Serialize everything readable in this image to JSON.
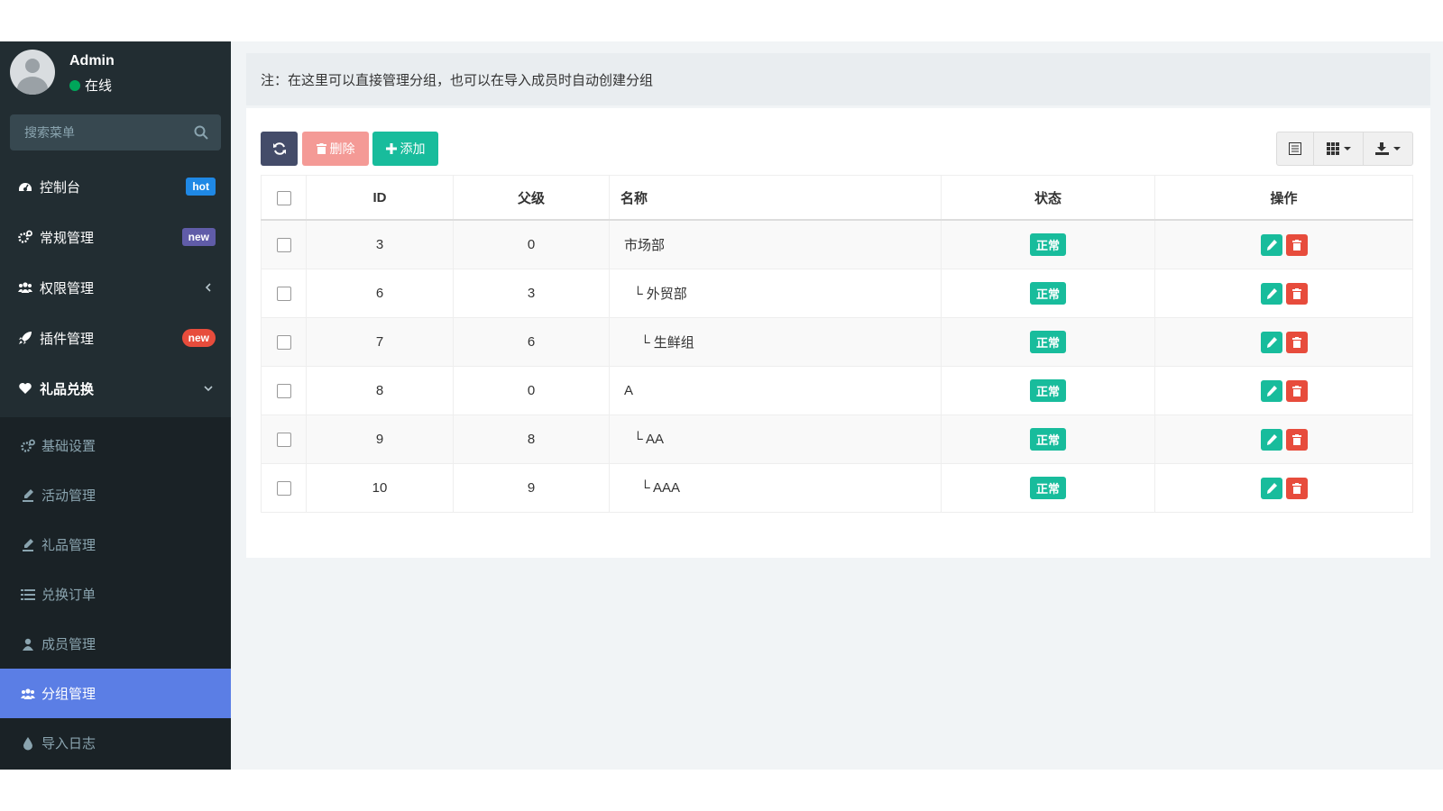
{
  "user": {
    "name": "Admin",
    "status": "在线"
  },
  "search": {
    "placeholder": "搜索菜单"
  },
  "menu": [
    {
      "label": "控制台",
      "icon": "dashboard-icon",
      "badge": "hot",
      "badge_color": "#1f88e5"
    },
    {
      "label": "常规管理",
      "icon": "cogs-icon",
      "badge": "new",
      "badge_color": "#605ca8"
    },
    {
      "label": "权限管理",
      "icon": "group-icon",
      "chevron": "left"
    },
    {
      "label": "插件管理",
      "icon": "rocket-icon",
      "badge": "new",
      "badge_color": "#e74c3c"
    },
    {
      "label": "礼品兑换",
      "icon": "heart-icon",
      "chevron": "down"
    }
  ],
  "submenu": [
    {
      "label": "基础设置",
      "icon": "cogs-icon"
    },
    {
      "label": "活动管理",
      "icon": "pencil-icon"
    },
    {
      "label": "礼品管理",
      "icon": "pencil-icon"
    },
    {
      "label": "兑换订单",
      "icon": "list-icon"
    },
    {
      "label": "成员管理",
      "icon": "user-icon"
    },
    {
      "label": "分组管理",
      "icon": "group-icon",
      "active": true
    },
    {
      "label": "导入日志",
      "icon": "tint-icon"
    }
  ],
  "notice": "注：在这里可以直接管理分组，也可以在导入成员时自动创建分组",
  "toolbar": {
    "delete_label": "删除",
    "add_label": "添加"
  },
  "table": {
    "columns": [
      "ID",
      "父级",
      "名称",
      "状态",
      "操作"
    ],
    "rows": [
      {
        "id": "3",
        "parent": "0",
        "name": "市场部",
        "status": "正常"
      },
      {
        "id": "6",
        "parent": "3",
        "name": "└ 外贸部",
        "status": "正常"
      },
      {
        "id": "7",
        "parent": "6",
        "name": "└ 生鲜组",
        "status": "正常"
      },
      {
        "id": "8",
        "parent": "0",
        "name": "A",
        "status": "正常"
      },
      {
        "id": "9",
        "parent": "8",
        "name": "└ AA",
        "status": "正常"
      },
      {
        "id": "10",
        "parent": "9",
        "name": "└ AAA",
        "status": "正常"
      }
    ]
  },
  "colors": {
    "accent": "#18bc9c",
    "danger": "#e74c3c",
    "sidebar": "#222d32",
    "active": "#5b7ee5"
  }
}
